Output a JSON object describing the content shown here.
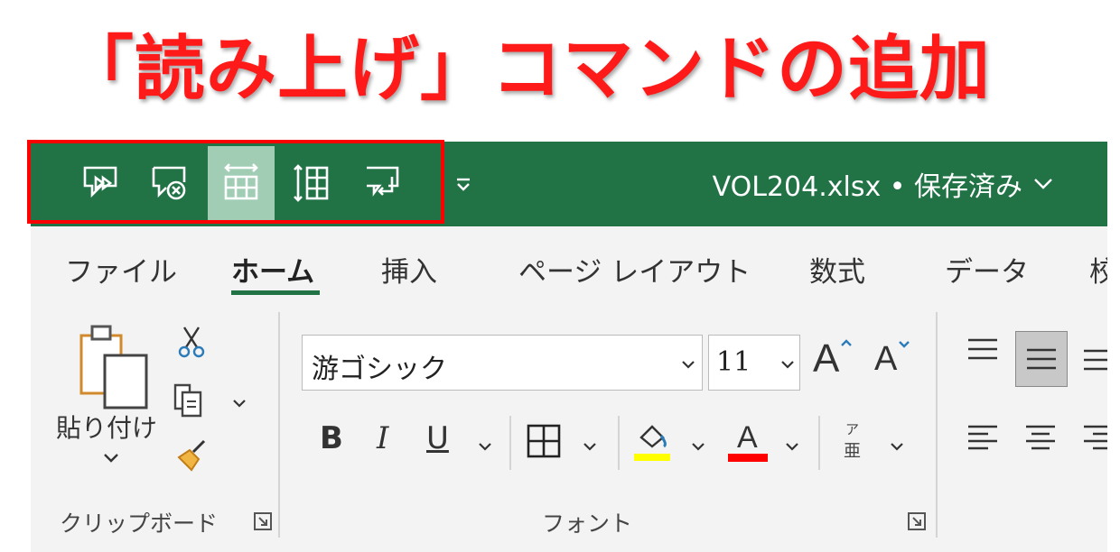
{
  "headline": "「読み上げ」コマンドの追加",
  "title_bar": {
    "document_title": "VOL204.xlsx • 保存済み",
    "qat_icons": [
      "speak-cells-icon",
      "stop-speaking-icon",
      "speak-by-rows-icon",
      "speak-by-columns-icon",
      "speak-on-enter-icon"
    ],
    "qat_active_index": 2
  },
  "tabs": [
    "ファイル",
    "ホーム",
    "挿入",
    "ページ レイアウト",
    "数式",
    "データ",
    "校"
  ],
  "active_tab": "ホーム",
  "clipboard": {
    "paste_label": "貼り付け",
    "group_label": "クリップボード"
  },
  "font": {
    "font_name": "游ゴシック",
    "font_size": "11",
    "increase_label": "A",
    "decrease_label": "A",
    "bold": "B",
    "italic": "I",
    "underline": "U",
    "font_color_label": "A",
    "phonetic_top": "ア",
    "phonetic_bottom": "亜",
    "group_label": "フォント"
  },
  "colors": {
    "title_bar": "#217346",
    "highlight": "#ff0000",
    "fill_color": "#ffff00",
    "font_color": "#ff0000"
  }
}
